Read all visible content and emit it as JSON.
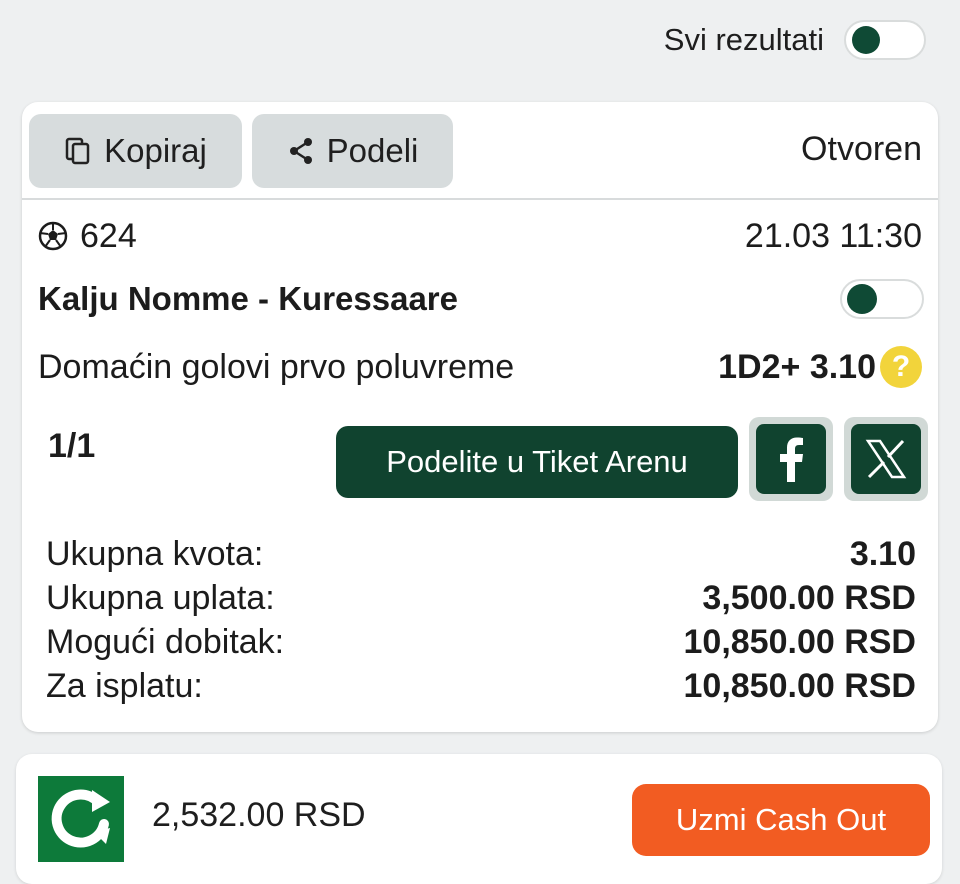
{
  "top": {
    "all_results_label": "Svi rezultati",
    "all_results_toggle_on": true
  },
  "ticket": {
    "copy_label": "Kopiraj",
    "share_label": "Podeli",
    "status": "Otvoren",
    "event": {
      "sport_icon": "soccer-ball-icon",
      "code": "624",
      "datetime": "21.03 11:30",
      "match": "Kalju Nomme - Kuressaare",
      "market": "Domaćin golovi prvo poluvreme",
      "pick": "1D2+ 3.10",
      "help_icon": "?"
    },
    "count": "1/1",
    "arena_button": "Podelite u Tiket Arenu",
    "facebook_icon": "facebook-icon",
    "x_icon": "x-icon",
    "totals": [
      {
        "label": "Ukupna kvota:",
        "value": "3.10"
      },
      {
        "label": "Ukupna uplata:",
        "value": "3,500.00 RSD"
      },
      {
        "label": "Mogući dobitak:",
        "value": "10,850.00 RSD"
      },
      {
        "label": "Za isplatu:",
        "value": "10,850.00 RSD"
      }
    ]
  },
  "cashout": {
    "logo_icon": "cashout-logo-icon",
    "amount": "2,532.00 RSD",
    "button": "Uzmi Cash Out"
  },
  "colors": {
    "brand_green": "#10432f",
    "cashout_orange": "#f25c22",
    "help_yellow": "#f2d43b"
  }
}
